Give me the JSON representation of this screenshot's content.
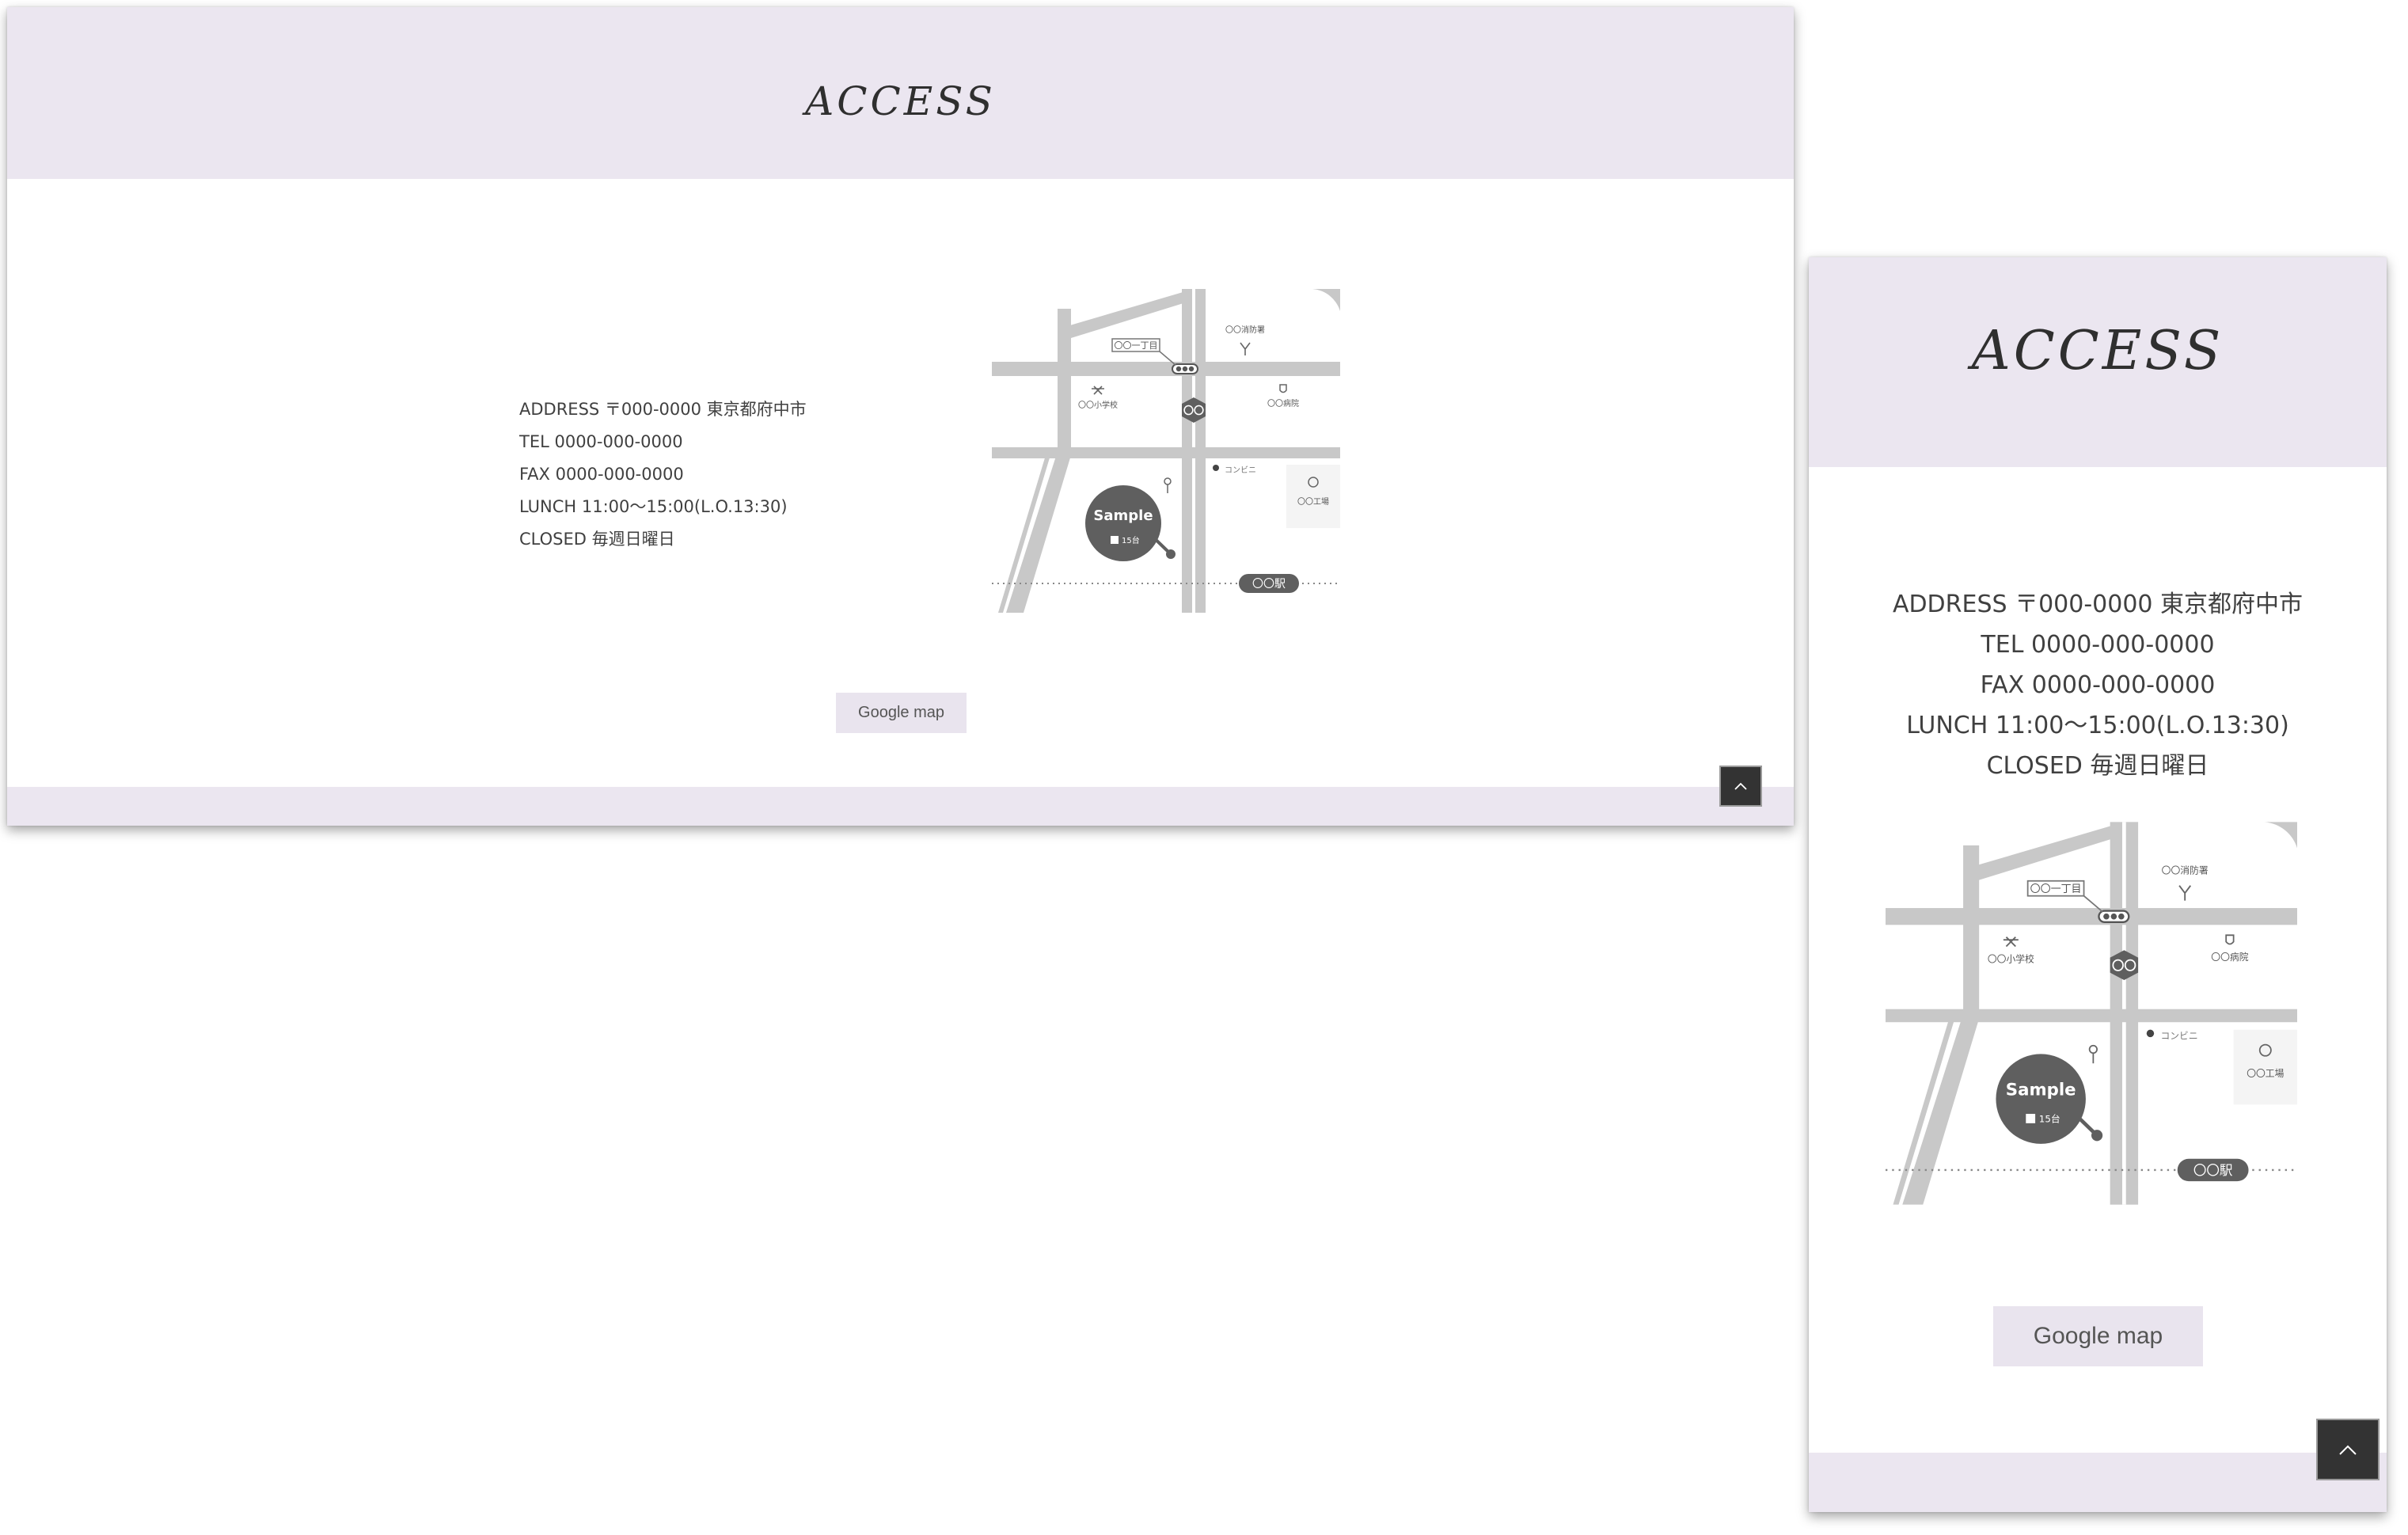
{
  "section_title": "ACCESS",
  "info_lines": [
    "ADDRESS 〒000-0000 東京都府中市",
    "TEL 0000-000-0000",
    "FAX 0000-000-0000",
    "LUNCH 11:00〜15:00(L.O.13:30)",
    "CLOSED 毎週日曜日"
  ],
  "map_button_label": "Google map",
  "map_labels": {
    "chome": "〇〇一丁目",
    "fire_station": "〇〇消防署",
    "school": "〇〇小学校",
    "route": "〇〇",
    "hospital": "〇〇病院",
    "convenience": "コンビニ",
    "factory": "〇〇工場",
    "shop": "Sample",
    "parking": "15台",
    "station": "〇〇駅"
  },
  "icons": {
    "to_top": "chevron-up-icon",
    "school": "school-icon",
    "fire_station": "fire-station-icon",
    "hospital": "hospital-icon",
    "factory": "factory-icon",
    "parking": "parking-icon"
  },
  "colors": {
    "band": "#ebe6f0",
    "button_bg": "#e9e4ee",
    "road": "#c8c8c8",
    "marker": "#5f5f5f",
    "to_top_bg": "#333333"
  }
}
